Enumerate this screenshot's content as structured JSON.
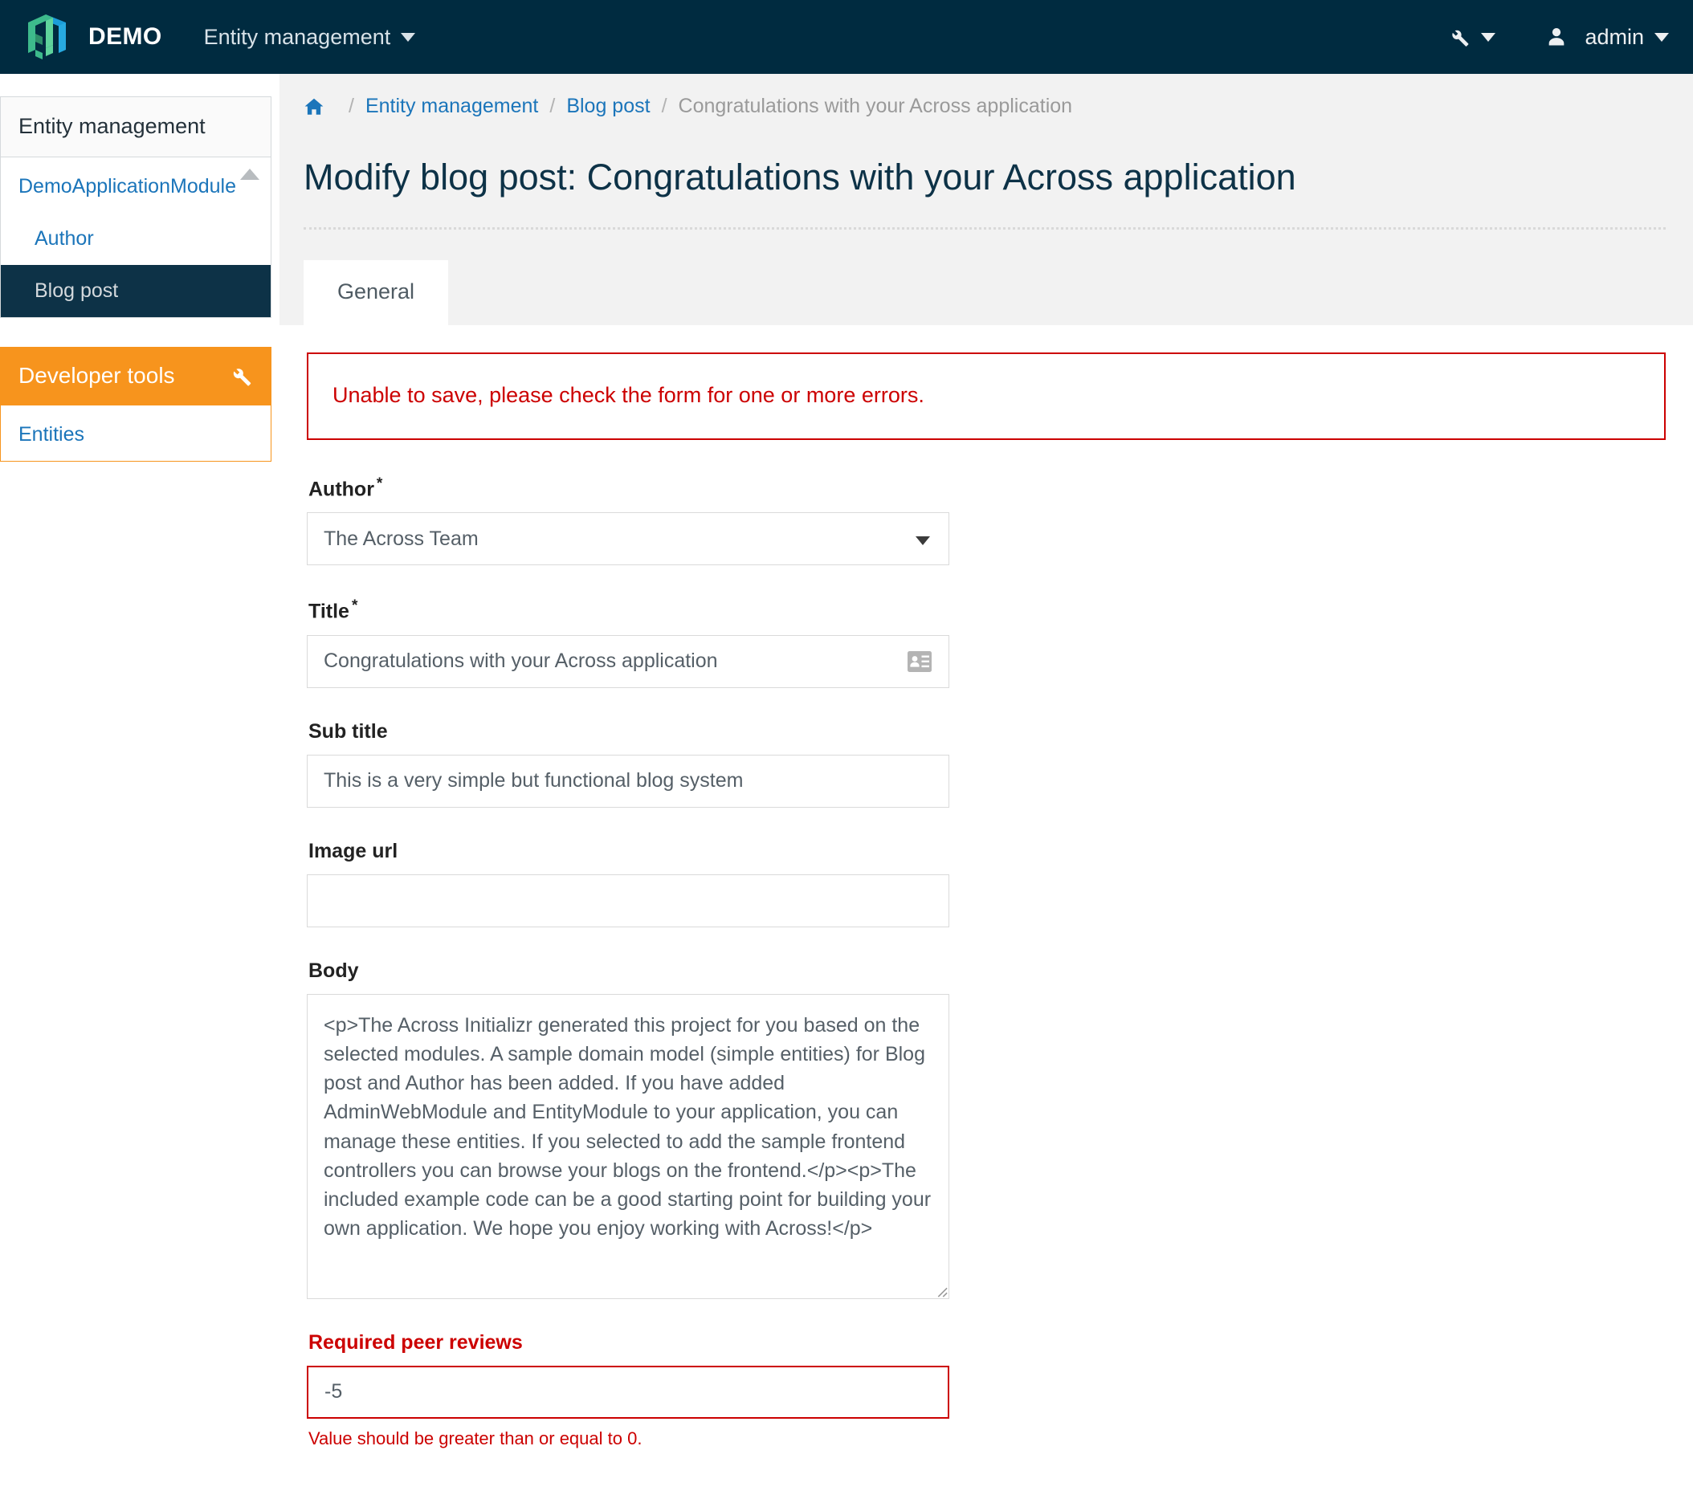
{
  "navbar": {
    "brand": "DEMO",
    "logo_icon": "across-cube-logo",
    "main_menu": [
      {
        "label": "Entity management",
        "icon": "chevron-down-icon"
      }
    ],
    "tools_icon": "wrench-icon",
    "user_icon": "user-icon",
    "user_label": "admin",
    "background_color": "#002b40"
  },
  "sidebar": {
    "panels": [
      {
        "title": "Entity management",
        "items": [
          {
            "label": "DemoApplicationModule",
            "level": 0,
            "active": false,
            "caret": "caret-up-icon"
          },
          {
            "label": "Author",
            "level": 1,
            "active": false
          },
          {
            "label": "Blog post",
            "level": 1,
            "active": true
          }
        ]
      },
      {
        "title": "Developer tools",
        "icon": "wrench-icon",
        "accent_color": "#f7941d",
        "items": [
          {
            "label": "Entities",
            "level": 0,
            "active": false
          }
        ]
      }
    ]
  },
  "breadcrumb": {
    "home_icon": "home-icon",
    "separator": "/",
    "items": [
      {
        "label": "Entity management",
        "link": true
      },
      {
        "label": "Blog post",
        "link": true
      },
      {
        "label": "Congratulations with your Across application",
        "link": false
      }
    ]
  },
  "page": {
    "title": "Modify blog post: Congratulations with your Across application"
  },
  "tabs": [
    {
      "label": "General",
      "active": true
    }
  ],
  "alert": {
    "message": "Unable to save, please check the form for one or more errors.",
    "color": "#cc0000"
  },
  "form": {
    "author": {
      "label": "Author",
      "required_marker": "*",
      "value": "The Across Team",
      "caret_icon": "chevron-down-icon"
    },
    "title": {
      "label": "Title",
      "required_marker": "*",
      "value": "Congratulations with your Across application",
      "icon": "id-card-icon"
    },
    "sub_title": {
      "label": "Sub title",
      "value": "This is a very simple but functional blog system"
    },
    "image_url": {
      "label": "Image url",
      "value": ""
    },
    "body": {
      "label": "Body",
      "value": "<p>The Across Initializr generated this project for you based on the selected modules. A sample domain model (simple entities) for Blog post and Author has been added. If you have added AdminWebModule and EntityModule to your application, you can manage these entities. If you selected to add the sample frontend controllers you can browse your blogs on the frontend.</p><p>The included example code can be a good starting point for building your own application. We hope you enjoy working with Across!</p>"
    },
    "required_peer_reviews": {
      "label": "Required peer reviews",
      "value": "-5",
      "error": "Value should be greater than or equal to 0.",
      "has_error": true
    }
  }
}
